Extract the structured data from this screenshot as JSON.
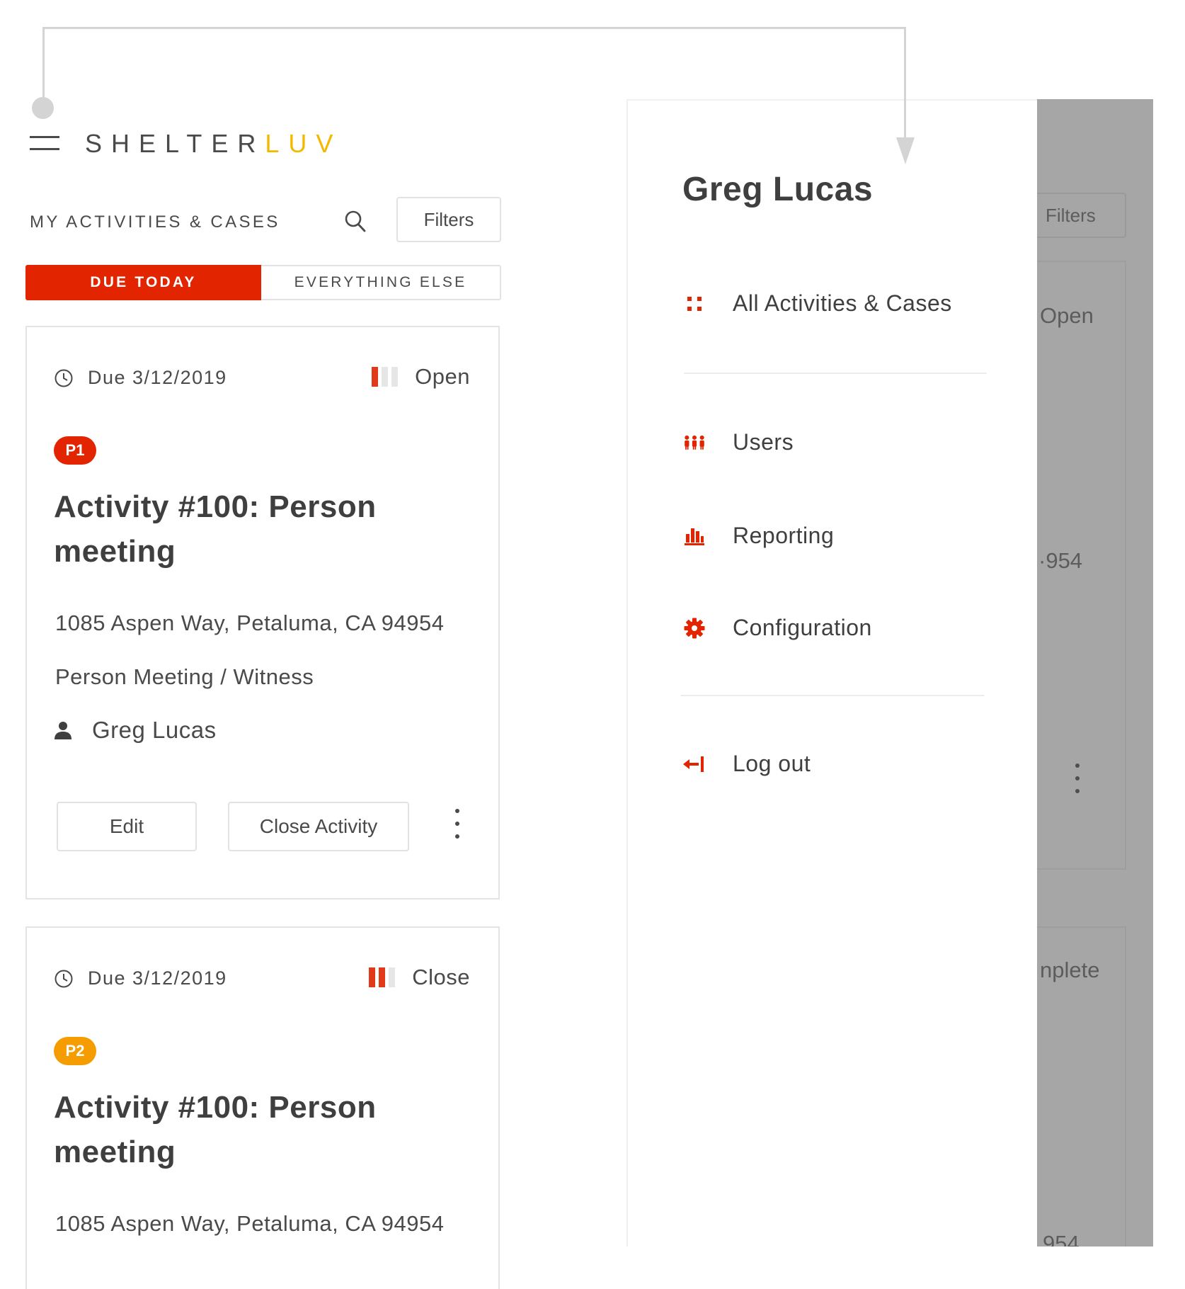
{
  "brand": {
    "name_main": "SHELTER",
    "name_accent": "LUV",
    "accent_color": "#f5b800"
  },
  "colors": {
    "primary_red": "#e22400",
    "priority_orange": "#f59c00"
  },
  "header": {
    "section_title": "MY ACTIVITIES & CASES",
    "filters_label": "Filters",
    "icons": {
      "menu": "hamburger-icon",
      "search": "search-icon"
    }
  },
  "tabs": {
    "active": "DUE TODAY",
    "inactive": "EVERYTHING ELSE"
  },
  "cards": [
    {
      "due": "Due 3/12/2019",
      "status": "Open",
      "status_level": 1,
      "priority": "P1",
      "title": "Activity #100: Person meeting",
      "address": "1085 Aspen Way, Petaluma, CA 94954",
      "type": "Person Meeting / Witness",
      "assignee": "Greg Lucas",
      "edit_label": "Edit",
      "close_label": "Close Activity"
    },
    {
      "due": "Due 3/12/2019",
      "status": "Close",
      "status_level": 2,
      "priority": "P2",
      "title": "Activity #100: Person meeting",
      "address": "1085 Aspen Way, Petaluma, CA 94954"
    }
  ],
  "drawer": {
    "user_name": "Greg Lucas",
    "menu": [
      {
        "label": "All Activities & Cases",
        "icon": "grid-icon"
      },
      {
        "label": "Users",
        "icon": "users-icon"
      },
      {
        "label": "Reporting",
        "icon": "bar-chart-icon"
      },
      {
        "label": "Configuration",
        "icon": "gear-icon"
      },
      {
        "label": "Log out",
        "icon": "logout-icon"
      }
    ]
  },
  "overlay": {
    "filters": "Filters",
    "status_open": "Open",
    "zip_fragment": "·954",
    "status_fragment": "nplete",
    "bottom_fragment": "954"
  }
}
